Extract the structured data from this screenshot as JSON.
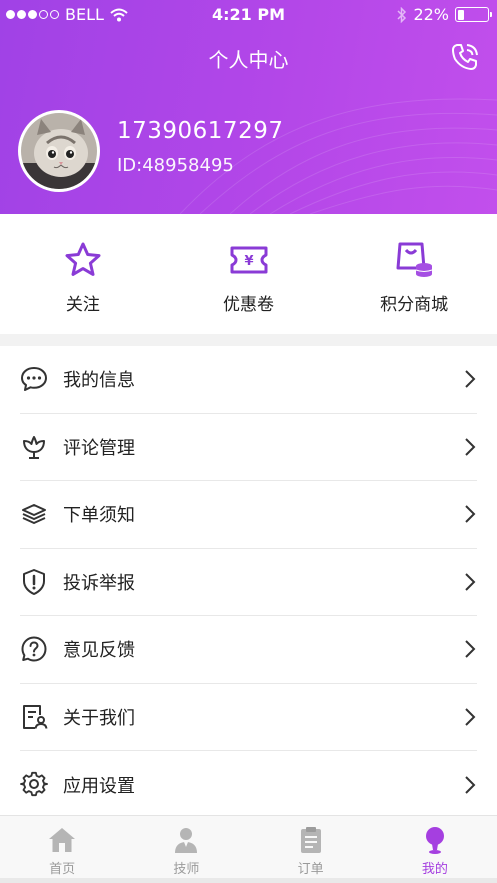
{
  "status_bar": {
    "carrier": "BELL",
    "time": "4:21 PM",
    "battery": "22%",
    "battery_level": 0.22
  },
  "header": {
    "title": "个人中心",
    "phone_icon": "phone-icon",
    "accent_color": "#a53fe0"
  },
  "profile": {
    "phone_number": "17390617297",
    "user_id": "ID:48958495"
  },
  "quick_actions": [
    {
      "label": "关注",
      "icon": "star-icon"
    },
    {
      "label": "优惠卷",
      "icon": "coupon-icon"
    },
    {
      "label": "积分商城",
      "icon": "points-mall-icon"
    }
  ],
  "menu": [
    {
      "label": "我的信息",
      "icon": "chat-bubble-icon"
    },
    {
      "label": "评论管理",
      "icon": "flower-icon"
    },
    {
      "label": "下单须知",
      "icon": "layers-icon"
    },
    {
      "label": "投诉举报",
      "icon": "shield-alert-icon"
    },
    {
      "label": "意见反馈",
      "icon": "question-bubble-icon"
    },
    {
      "label": "关于我们",
      "icon": "document-user-icon"
    },
    {
      "label": "应用设置",
      "icon": "gear-icon"
    }
  ],
  "tabs": [
    {
      "label": "首页",
      "icon": "home-icon",
      "active": false
    },
    {
      "label": "技师",
      "icon": "technician-icon",
      "active": false
    },
    {
      "label": "订单",
      "icon": "clipboard-icon",
      "active": false
    },
    {
      "label": "我的",
      "icon": "user-icon",
      "active": true
    }
  ]
}
